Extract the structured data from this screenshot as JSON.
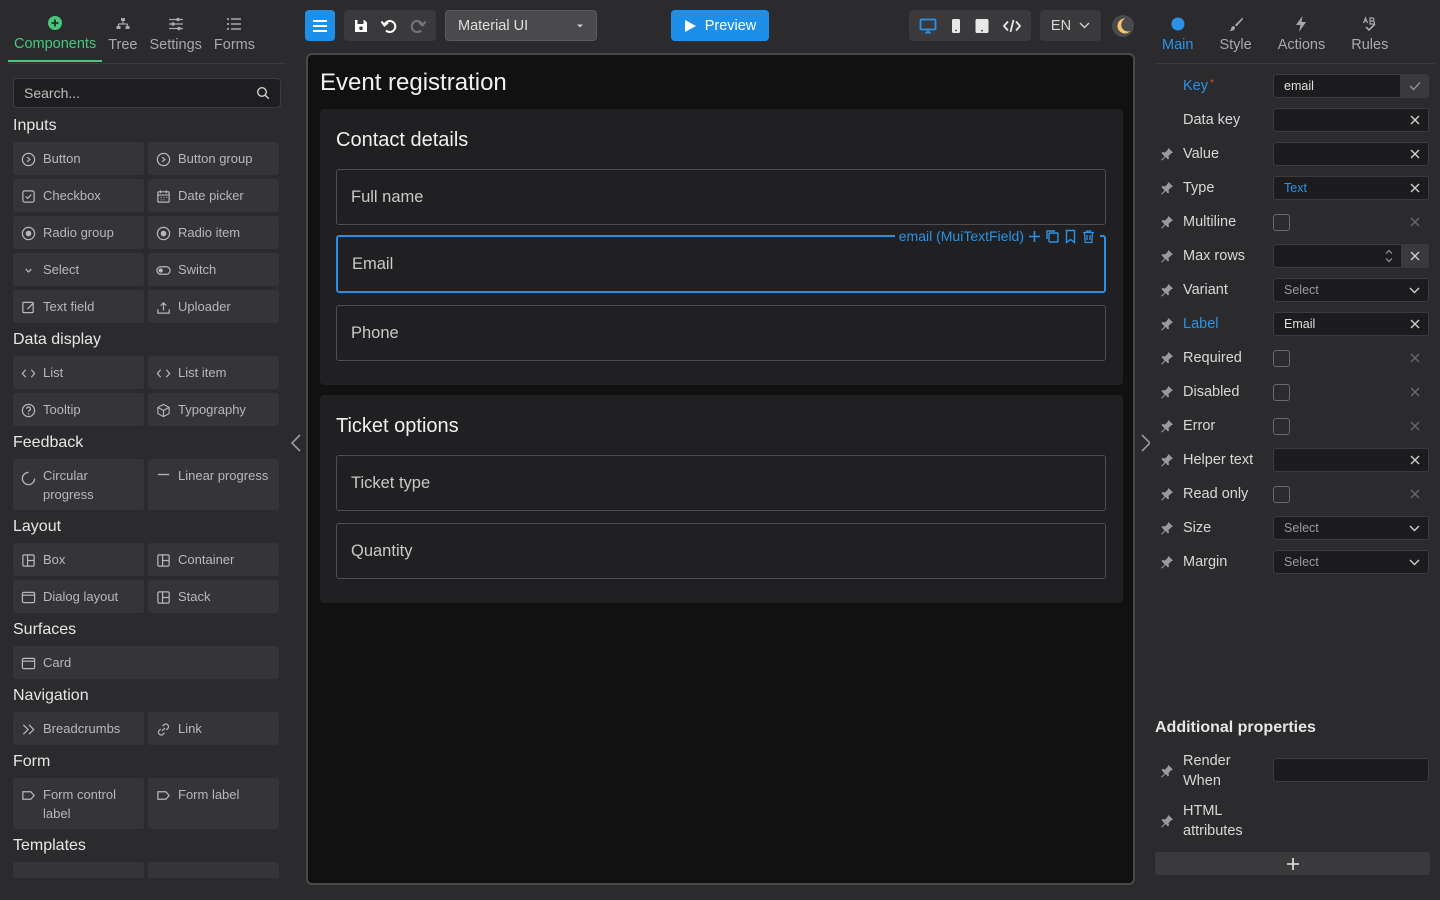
{
  "left_panel": {
    "tabs": [
      {
        "label": "Components",
        "icon": "plus-circle-icon",
        "active": true
      },
      {
        "label": "Tree",
        "icon": "tree-icon"
      },
      {
        "label": "Settings",
        "icon": "sliders-icon"
      },
      {
        "label": "Forms",
        "icon": "list-icon"
      }
    ],
    "search": {
      "placeholder": "Search...",
      "value": ""
    },
    "categories": {
      "inputs": "Inputs",
      "data_display": "Data display",
      "feedback": "Feedback",
      "layout": "Layout",
      "surfaces": "Surfaces",
      "navigation": "Navigation",
      "form": "Form",
      "templates": "Templates"
    },
    "components": {
      "button": "Button",
      "button_group": "Button group",
      "checkbox": "Checkbox",
      "date_picker": "Date picker",
      "radio_group": "Radio group",
      "radio_item": "Radio item",
      "select": "Select",
      "switch": "Switch",
      "text_field": "Text field",
      "uploader": "Uploader",
      "list": "List",
      "list_item": "List item",
      "tooltip": "Tooltip",
      "typography": "Typography",
      "circular_progress": "Circular progress",
      "linear_progress": "Linear progress",
      "box": "Box",
      "container": "Container",
      "dialog_layout": "Dialog layout",
      "stack": "Stack",
      "card": "Card",
      "breadcrumbs": "Breadcrumbs",
      "link": "Link",
      "form_control_label": "Form control label",
      "form_label": "Form label"
    }
  },
  "toolbar": {
    "library": "Material UI",
    "preview_label": "Preview",
    "language": "EN"
  },
  "canvas": {
    "form_title": "Event registration",
    "sections": [
      {
        "title": "Contact details",
        "fields": [
          "Full name",
          "Email",
          "Phone"
        ]
      },
      {
        "title": "Ticket options",
        "fields": [
          "Ticket type",
          "Quantity"
        ]
      }
    ],
    "selected_tag": "email (MuiTextField)"
  },
  "right_panel": {
    "tabs": [
      {
        "label": "Main",
        "icon": "dot-icon",
        "active": true
      },
      {
        "label": "Style",
        "icon": "brush-icon"
      },
      {
        "label": "Actions",
        "icon": "bolt-icon"
      },
      {
        "label": "Rules",
        "icon": "rules-icon"
      }
    ],
    "props": {
      "key": {
        "label": "Key",
        "value": "email"
      },
      "data_key": {
        "label": "Data key",
        "value": ""
      },
      "value": {
        "label": "Value",
        "value": ""
      },
      "type": {
        "label": "Type",
        "value": "Text"
      },
      "multiline": {
        "label": "Multiline"
      },
      "max_rows": {
        "label": "Max rows",
        "value": ""
      },
      "variant": {
        "label": "Variant",
        "value": "Select"
      },
      "label": {
        "label": "Label",
        "value": "Email"
      },
      "required": {
        "label": "Required"
      },
      "disabled": {
        "label": "Disabled"
      },
      "error": {
        "label": "Error"
      },
      "helper_text": {
        "label": "Helper text",
        "value": ""
      },
      "read_only": {
        "label": "Read only"
      },
      "size": {
        "label": "Size",
        "value": "Select"
      },
      "margin": {
        "label": "Margin",
        "value": "Select"
      }
    },
    "additional": {
      "title": "Additional properties",
      "render_when": "Render When",
      "html_attributes": "HTML attributes"
    }
  },
  "colors": {
    "accent_green": "#48c77c",
    "accent_blue": "#2a93e6",
    "primary_button": "#1e8fe8"
  }
}
